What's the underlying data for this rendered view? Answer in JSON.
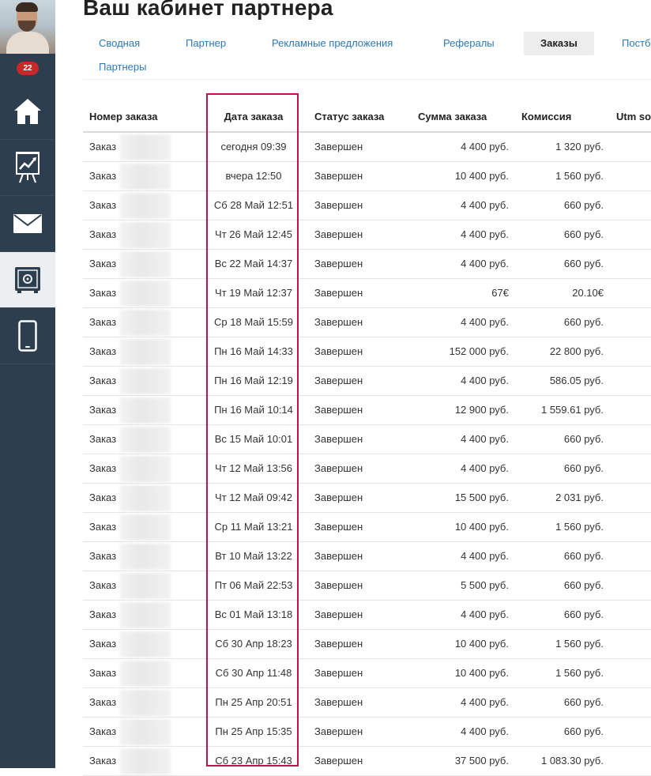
{
  "notifications": {
    "count": "22"
  },
  "sidebar": {
    "items": [
      {
        "icon": "home-icon"
      },
      {
        "icon": "chart-easel-icon"
      },
      {
        "icon": "mail-icon"
      },
      {
        "icon": "safe-icon"
      },
      {
        "icon": "mobile-icon"
      }
    ],
    "active_index": 3
  },
  "header": {
    "title": "Ваш кабинет партнера"
  },
  "tabs": [
    {
      "label": "Сводная"
    },
    {
      "label": "Партнер"
    },
    {
      "label": "Рекламные предложения"
    },
    {
      "label": "Рефералы"
    },
    {
      "label": "Заказы"
    },
    {
      "label": "Постб"
    },
    {
      "label": "Партнеры"
    }
  ],
  "active_tab": "Заказы",
  "table": {
    "columns": [
      "Номер заказа",
      "Дата заказа",
      "Статус заказа",
      "Сумма заказа",
      "Комиссия",
      "Utm so"
    ],
    "rows": [
      {
        "number": "Заказ",
        "date": "сегодня 09:39",
        "status": "Завершен",
        "sum": "4 400 руб.",
        "commission": "1 320 руб."
      },
      {
        "number": "Заказ",
        "date": "вчера 12:50",
        "status": "Завершен",
        "sum": "10 400 руб.",
        "commission": "1 560 руб."
      },
      {
        "number": "Заказ",
        "date": "Сб 28 Май 12:51",
        "status": "Завершен",
        "sum": "4 400 руб.",
        "commission": "660 руб."
      },
      {
        "number": "Заказ",
        "date": "Чт 26 Май 12:45",
        "status": "Завершен",
        "sum": "4 400 руб.",
        "commission": "660 руб."
      },
      {
        "number": "Заказ",
        "date": "Вс 22 Май 14:37",
        "status": "Завершен",
        "sum": "4 400 руб.",
        "commission": "660 руб."
      },
      {
        "number": "Заказ",
        "date": "Чт 19 Май 12:37",
        "status": "Завершен",
        "sum": "67€",
        "commission": "20.10€"
      },
      {
        "number": "Заказ",
        "date": "Ср 18 Май 15:59",
        "status": "Завершен",
        "sum": "4 400 руб.",
        "commission": "660 руб."
      },
      {
        "number": "Заказ",
        "date": "Пн 16 Май 14:33",
        "status": "Завершен",
        "sum": "152 000 руб.",
        "commission": "22 800 руб."
      },
      {
        "number": "Заказ",
        "date": "Пн 16 Май 12:19",
        "status": "Завершен",
        "sum": "4 400 руб.",
        "commission": "586.05 руб."
      },
      {
        "number": "Заказ",
        "date": "Пн 16 Май 10:14",
        "status": "Завершен",
        "sum": "12 900 руб.",
        "commission": "1 559.61 руб."
      },
      {
        "number": "Заказ",
        "date": "Вс 15 Май 10:01",
        "status": "Завершен",
        "sum": "4 400 руб.",
        "commission": "660 руб."
      },
      {
        "number": "Заказ",
        "date": "Чт 12 Май 13:56",
        "status": "Завершен",
        "sum": "4 400 руб.",
        "commission": "660 руб."
      },
      {
        "number": "Заказ",
        "date": "Чт 12 Май 09:42",
        "status": "Завершен",
        "sum": "15 500 руб.",
        "commission": "2 031 руб."
      },
      {
        "number": "Заказ",
        "date": "Ср 11 Май 13:21",
        "status": "Завершен",
        "sum": "10 400 руб.",
        "commission": "1 560 руб."
      },
      {
        "number": "Заказ",
        "date": "Вт 10 Май 13:22",
        "status": "Завершен",
        "sum": "4 400 руб.",
        "commission": "660 руб."
      },
      {
        "number": "Заказ",
        "date": "Пт 06 Май 22:53",
        "status": "Завершен",
        "sum": "5 500 руб.",
        "commission": "660 руб."
      },
      {
        "number": "Заказ",
        "date": "Вс 01 Май 13:18",
        "status": "Завершен",
        "sum": "4 400 руб.",
        "commission": "660 руб."
      },
      {
        "number": "Заказ",
        "date": "Сб 30 Апр 18:23",
        "status": "Завершен",
        "sum": "10 400 руб.",
        "commission": "1 560 руб."
      },
      {
        "number": "Заказ",
        "date": "Сб 30 Апр 11:48",
        "status": "Завершен",
        "sum": "10 400 руб.",
        "commission": "1 560 руб."
      },
      {
        "number": "Заказ",
        "date": "Пн 25 Апр 20:51",
        "status": "Завершен",
        "sum": "4 400 руб.",
        "commission": "660 руб."
      },
      {
        "number": "Заказ",
        "date": "Пн 25 Апр 15:35",
        "status": "Завершен",
        "sum": "4 400 руб.",
        "commission": "660 руб."
      },
      {
        "number": "Заказ",
        "date": "Сб 23 Апр 15:43",
        "status": "Завершен",
        "sum": "37 500 руб.",
        "commission": "1 083.30 руб."
      }
    ]
  },
  "colors": {
    "sidebar_bg": "#2d3e4f",
    "badge_red": "#c52a2a",
    "link_blue": "#2c78b6",
    "highlight_border": "#c0144b"
  }
}
